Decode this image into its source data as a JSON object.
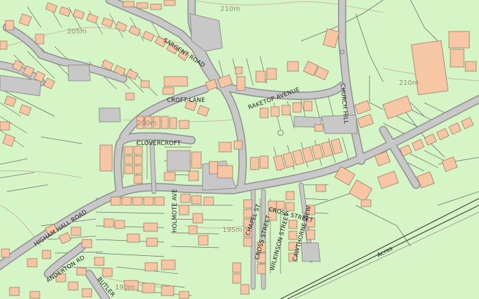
{
  "map": {
    "colors": {
      "land": "#d6f5c6",
      "road": "#c8c8c8",
      "road_edge": "#8f8f8f",
      "building": "#f7c6a4",
      "building_edge": "#9a7a64",
      "parcel_line": "#6b6b6b",
      "contour": "#c9b79e",
      "rail": "#444444"
    },
    "street_labels": {
      "sargent_road": "SARGENT ROAD",
      "croft_lane": "CROFT LANE",
      "raketop_avenue": "RAKETOP AVENUE",
      "clovercroft": "CLOVERCROFT",
      "holmote_ave": "HOLMOTE AVE",
      "higham_hall_road": "HIGHAM HALL ROAD",
      "chapel_st": "CHAPEL ST",
      "cross_street": "CROSS STREET",
      "wilkinson_street": "WILKINSON STREET",
      "cawthorne_view": "CAWTHORNE VIEW",
      "church_hill": "CHURCH HILL",
      "anderton_road": "ANDERTON RD",
      "butler": "BUTLER",
      "acros": "Acros"
    },
    "contour_labels": {
      "c210_top": "210m",
      "c205": "205m",
      "c210_right": "210m",
      "c200": "200m",
      "c195": "195m",
      "c190": "190m"
    }
  }
}
